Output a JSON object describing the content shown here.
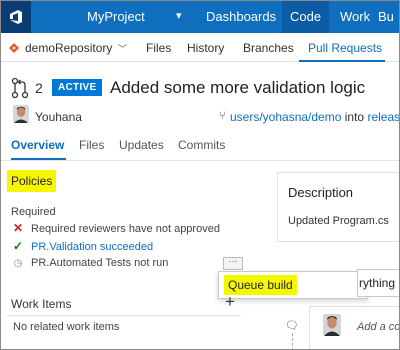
{
  "app": {
    "project_name": "MyProject",
    "hubs": [
      "Dashboards",
      "Code",
      "Work",
      "Bu"
    ],
    "active_hub": "Code"
  },
  "subnav": {
    "repo_name": "demoRepository",
    "items": [
      "Files",
      "History",
      "Branches",
      "Pull Requests"
    ],
    "active_item": "Pull Requests"
  },
  "pr": {
    "count": "2",
    "status": "ACTIVE",
    "title": "Added some more validation logic",
    "author": "Youhana",
    "source_branch": "users/yohasna/demo",
    "into_label": "into",
    "target_branch": "release"
  },
  "tabs": [
    "Overview",
    "Files",
    "Updates",
    "Commits"
  ],
  "active_tab": "Overview",
  "policies": {
    "title": "Policies",
    "required_label": "Required",
    "items": [
      {
        "text": "Required reviewers have not approved",
        "status": "failed",
        "icon": "x-icon"
      },
      {
        "text": "PR.Validation succeeded",
        "status": "succeeded",
        "icon": "check-icon"
      },
      {
        "text": "PR.Automated Tests not run",
        "status": "not-run",
        "icon": "clock-icon"
      }
    ],
    "more_label": "···"
  },
  "context_menu": {
    "items": [
      "Queue build"
    ]
  },
  "work_items": {
    "title": "Work Items",
    "add_label": "+",
    "empty_text": "No related work items"
  },
  "description": {
    "title": "Description",
    "text": "Updated Program.cs"
  },
  "filter": {
    "value": "rything"
  },
  "comment": {
    "placeholder": "Add a co"
  },
  "colors": {
    "topbar": "#106ebe",
    "accent": "#106ebe",
    "active_badge": "#0078d7",
    "highlight": "#f7f700",
    "error": "#c4262e",
    "success": "#107c10"
  }
}
